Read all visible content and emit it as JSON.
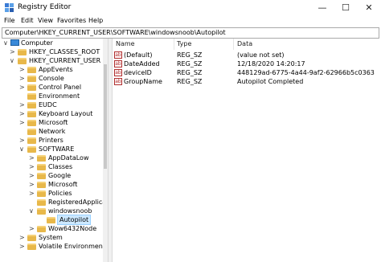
{
  "window": {
    "title": "Registry Editor",
    "controls": {
      "minimize": "—",
      "maximize": "☐",
      "close": "✕"
    }
  },
  "menu": [
    "File",
    "Edit",
    "View",
    "Favorites",
    "Help"
  ],
  "address": "Computer\\HKEY_CURRENT_USER\\SOFTWARE\\windowsnoob\\Autopilot",
  "tree": [
    {
      "label": "Computer",
      "expander": "∨"
    },
    {
      "label": "HKEY_CLASSES_ROOT",
      "expander": ">"
    },
    {
      "label": "HKEY_CURRENT_USER",
      "expander": "∨"
    },
    {
      "label": "AppEvents",
      "expander": ">"
    },
    {
      "label": "Console",
      "expander": ">"
    },
    {
      "label": "Control Panel",
      "expander": ">"
    },
    {
      "label": "Environment",
      "expander": ""
    },
    {
      "label": "EUDC",
      "expander": ">"
    },
    {
      "label": "Keyboard Layout",
      "expander": ">"
    },
    {
      "label": "Microsoft",
      "expander": ">"
    },
    {
      "label": "Network",
      "expander": ""
    },
    {
      "label": "Printers",
      "expander": ">"
    },
    {
      "label": "SOFTWARE",
      "expander": "∨"
    },
    {
      "label": "AppDataLow",
      "expander": ">"
    },
    {
      "label": "Classes",
      "expander": ">"
    },
    {
      "label": "Google",
      "expander": ">"
    },
    {
      "label": "Microsoft",
      "expander": ">"
    },
    {
      "label": "Policies",
      "expander": ">"
    },
    {
      "label": "RegisteredApplicatio",
      "expander": ""
    },
    {
      "label": "windowsnoob",
      "expander": "∨"
    },
    {
      "label": "Autopilot",
      "expander": ""
    },
    {
      "label": "Wow6432Node",
      "expander": ">"
    },
    {
      "label": "System",
      "expander": ">"
    },
    {
      "label": "Volatile Environment",
      "expander": ">"
    }
  ],
  "columns": {
    "name": "Name",
    "type": "Type",
    "data": "Data"
  },
  "values": [
    {
      "icon": "ab",
      "name": "(Default)",
      "type": "REG_SZ",
      "data": "(value not set)"
    },
    {
      "icon": "ab",
      "name": "DateAdded",
      "type": "REG_SZ",
      "data": "12/18/2020 14:20:17"
    },
    {
      "icon": "ab",
      "name": "deviceID",
      "type": "REG_SZ",
      "data": "448129ad-6775-4a44-9af2-62966b5c0363"
    },
    {
      "icon": "ab",
      "name": "GroupName",
      "type": "REG_SZ",
      "data": "Autopilot Completed"
    }
  ]
}
